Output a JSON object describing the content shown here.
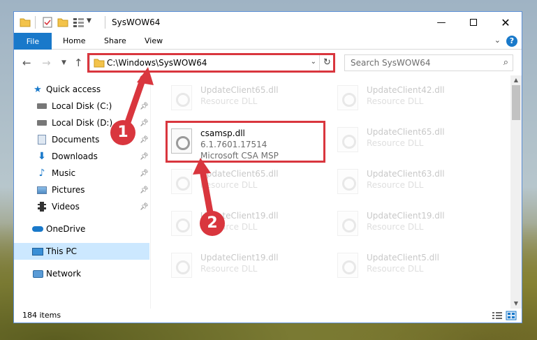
{
  "window": {
    "title": "SysWOW64"
  },
  "ribbon": {
    "tabs": [
      {
        "label": "File"
      },
      {
        "label": "Home"
      },
      {
        "label": "Share"
      },
      {
        "label": "View"
      }
    ],
    "help": "?"
  },
  "nav": {
    "address": "C:\\Windows\\SysWOW64",
    "search_placeholder": "Search SysWOW64"
  },
  "sidebar": {
    "items": [
      {
        "label": "Quick access",
        "icon": "star-icon",
        "pinned": false
      },
      {
        "label": "Local Disk (C:)",
        "icon": "drive-icon",
        "pinned": true
      },
      {
        "label": "Local Disk (D:)",
        "icon": "drive-icon",
        "pinned": true
      },
      {
        "label": "Documents",
        "icon": "documents-icon",
        "pinned": true
      },
      {
        "label": "Downloads",
        "icon": "download-icon",
        "pinned": true
      },
      {
        "label": "Music",
        "icon": "music-icon",
        "pinned": true
      },
      {
        "label": "Pictures",
        "icon": "pictures-icon",
        "pinned": true
      },
      {
        "label": "Videos",
        "icon": "videos-icon",
        "pinned": true
      },
      {
        "label": "OneDrive",
        "icon": "cloud-icon",
        "pinned": false
      },
      {
        "label": "This PC",
        "icon": "computer-icon",
        "pinned": false,
        "selected": true
      },
      {
        "label": "Network",
        "icon": "network-icon",
        "pinned": false
      }
    ]
  },
  "files": {
    "highlighted": {
      "name": "csamsp.dll",
      "version": "6.1.7601.17514",
      "description": "Microsoft CSA MSP"
    },
    "left_column": [
      {
        "name": "UpdateClient65.dll",
        "type": "Resource DLL"
      },
      {
        "name": "UpdateClient65.dll",
        "type": "Resource DLL"
      },
      {
        "name": "UpdateClient19.dll",
        "type": "Resource DLL"
      },
      {
        "name": "UpdateClient19.dll",
        "type": "Resource DLL"
      }
    ],
    "right_column": [
      {
        "name": "UpdateClient42.dll",
        "type": "Resource DLL"
      },
      {
        "name": "UpdateClient65.dll",
        "type": "Resource DLL"
      },
      {
        "name": "UpdateClient63.dll",
        "type": "Resource DLL"
      },
      {
        "name": "UpdateClient19.dll",
        "type": "Resource DLL"
      },
      {
        "name": "UpdateClient5.dll",
        "type": "Resource DLL"
      }
    ]
  },
  "status": {
    "item_count": "184 items"
  },
  "annotations": {
    "step1": "1",
    "step2": "2"
  },
  "colors": {
    "accent": "#1979ca",
    "highlight_box": "#d9363e",
    "selected_bg": "#cce8ff"
  }
}
